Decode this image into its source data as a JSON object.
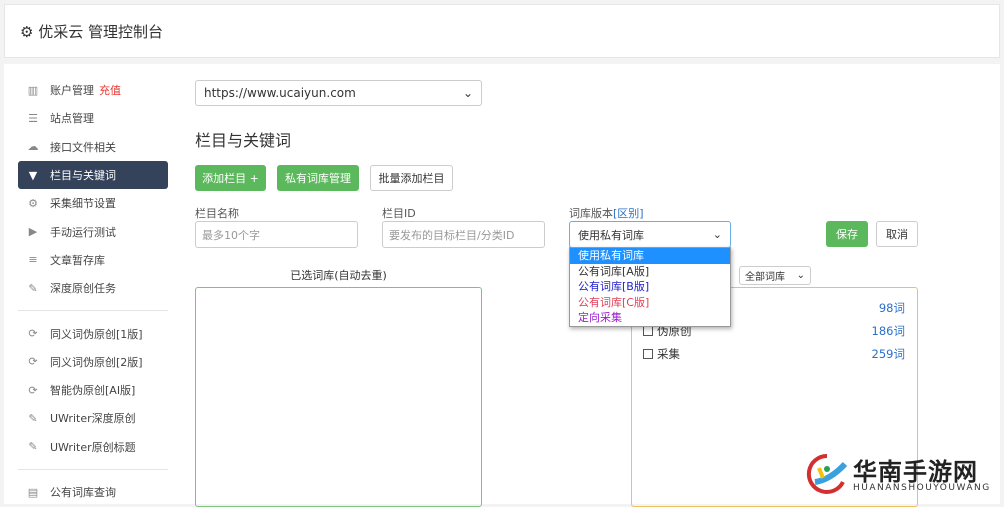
{
  "header": {
    "title": "优采云 管理控制台",
    "icon": "gear-icon"
  },
  "sidebar": {
    "items": [
      {
        "label": "账户管理",
        "badge": "充值",
        "icon": "bar-chart-icon"
      },
      {
        "label": "站点管理",
        "icon": "server-icon"
      },
      {
        "label": "接口文件相关",
        "icon": "cloud-upload-icon"
      },
      {
        "label": "栏目与关键词",
        "icon": "filter-icon",
        "active": true
      },
      {
        "label": "采集细节设置",
        "icon": "cogs-icon"
      },
      {
        "label": "手动运行测试",
        "icon": "play-circle-icon"
      },
      {
        "label": "文章暂存库",
        "icon": "database-icon"
      },
      {
        "label": "深度原创任务",
        "icon": "edit-icon"
      },
      {
        "label": "同义词伪原创[1版]",
        "icon": "refresh-icon"
      },
      {
        "label": "同义词伪原创[2版]",
        "icon": "refresh-icon"
      },
      {
        "label": "智能伪原创[AI版]",
        "icon": "refresh-icon"
      },
      {
        "label": "UWriter深度原创",
        "icon": "edit-icon"
      },
      {
        "label": "UWriter原创标题",
        "icon": "edit-icon"
      },
      {
        "label": "公有词库查询",
        "icon": "book-icon"
      }
    ]
  },
  "main": {
    "site_select": "https://www.ucaiyun.com",
    "title": "栏目与关键词",
    "buttons": {
      "add": "添加栏目 +",
      "private": "私有词库管理",
      "batch": "批量添加栏目",
      "save": "保存",
      "cancel": "取消"
    },
    "form": {
      "name_label": "栏目名称",
      "name_placeholder": "最多10个字",
      "id_label": "栏目ID",
      "id_placeholder": "要发布的目标栏目/分类ID",
      "lib_label": "词库版本",
      "lib_link": "[区别]",
      "lib_value": "使用私有词库"
    },
    "dropdown": [
      {
        "label": "使用私有词库",
        "color": "#ffffff",
        "selected": true
      },
      {
        "label": "公有词库[A版]",
        "color": "#333333"
      },
      {
        "label": "公有词库[B版]",
        "color": "#2222cc"
      },
      {
        "label": "公有词库[C版]",
        "color": "#e0405a"
      },
      {
        "label": "定向采集",
        "color": "#9b1fd1"
      }
    ],
    "selected_title": "已选词库(自动去重)",
    "filter_select": "全部词库",
    "libs": [
      {
        "label": "",
        "count": "98词"
      },
      {
        "label": "伪原创",
        "count": "186词"
      },
      {
        "label": "采集",
        "count": "259词"
      }
    ]
  },
  "watermark": {
    "text": "华南手游网",
    "sub": "HUANANSHOUYOUWANG"
  }
}
